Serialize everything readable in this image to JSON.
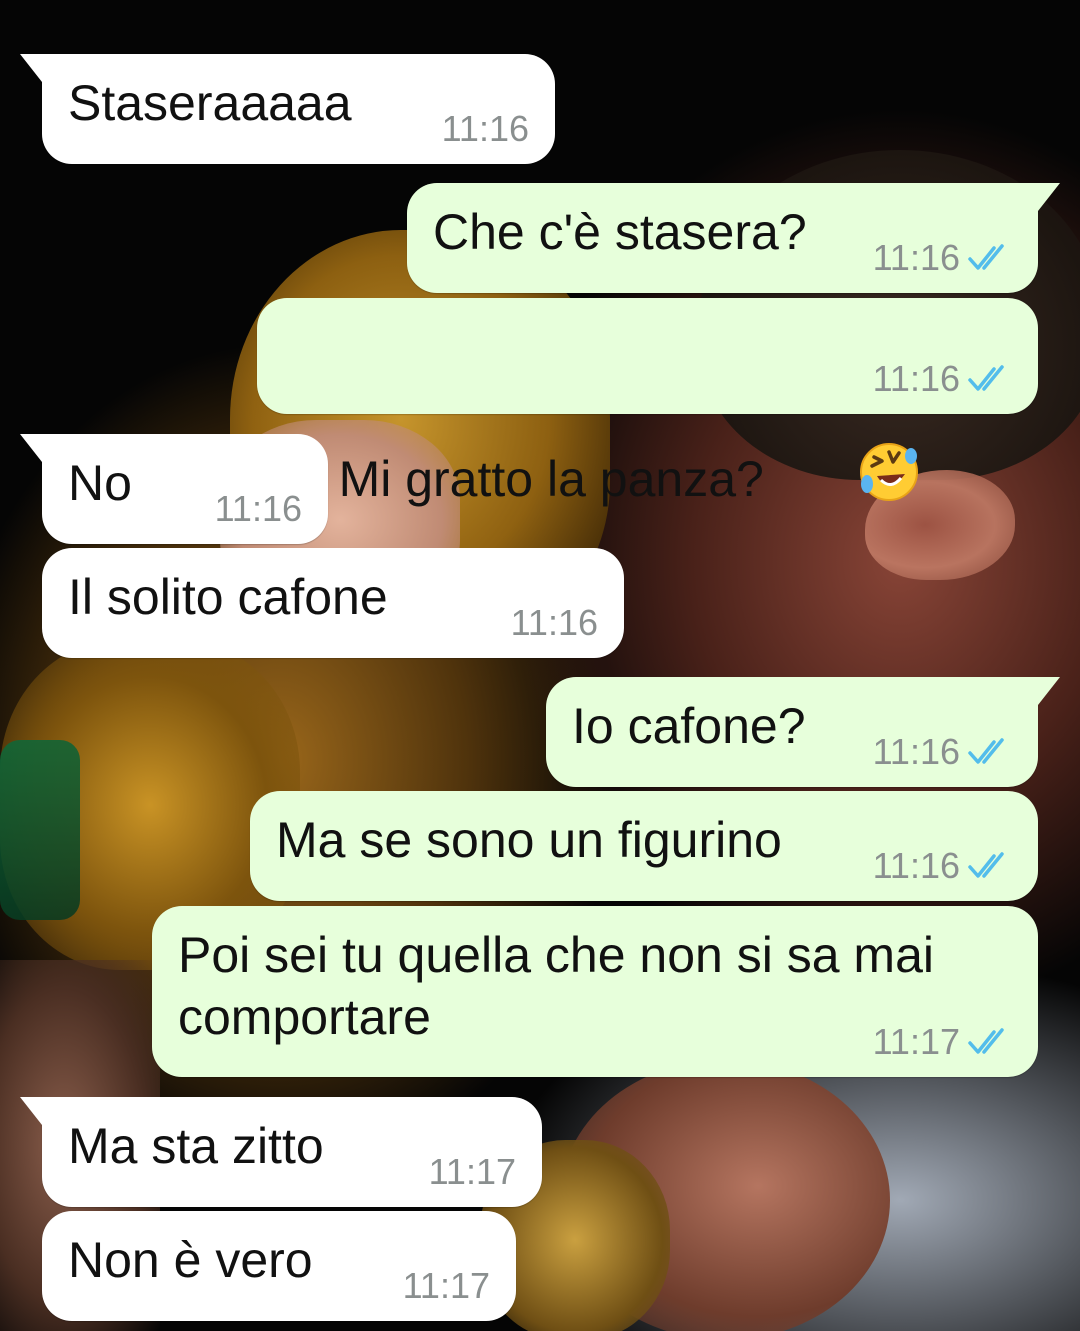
{
  "chat": {
    "messages": [
      {
        "direction": "incoming",
        "text": "Staseraaaaa",
        "time": "11:16"
      },
      {
        "direction": "outgoing",
        "text": "Che c'è stasera?",
        "time": "11:16",
        "status": "read"
      },
      {
        "direction": "outgoing",
        "text": "Mi gratto la panza?",
        "emoji": "rolling-on-floor-laughing",
        "time": "11:16",
        "status": "read"
      },
      {
        "direction": "incoming",
        "text": "No",
        "time": "11:16"
      },
      {
        "direction": "incoming",
        "text": "Il solito cafone",
        "time": "11:16"
      },
      {
        "direction": "outgoing",
        "text": "Io cafone?",
        "time": "11:16",
        "status": "read"
      },
      {
        "direction": "outgoing",
        "text": "Ma se sono un figurino",
        "time": "11:16",
        "status": "read"
      },
      {
        "direction": "outgoing",
        "text": "Poi sei tu quella che non si sa mai\ncomportare",
        "time": "11:17",
        "status": "read"
      },
      {
        "direction": "incoming",
        "text": "Ma sta zitto",
        "time": "11:17"
      },
      {
        "direction": "incoming",
        "text": "Non è vero",
        "time": "11:17"
      }
    ]
  },
  "colors": {
    "incoming_bubble": "#ffffff",
    "outgoing_bubble": "#e7ffdb",
    "read_check": "#53bdeb",
    "timestamp": "#8a8f8f"
  }
}
